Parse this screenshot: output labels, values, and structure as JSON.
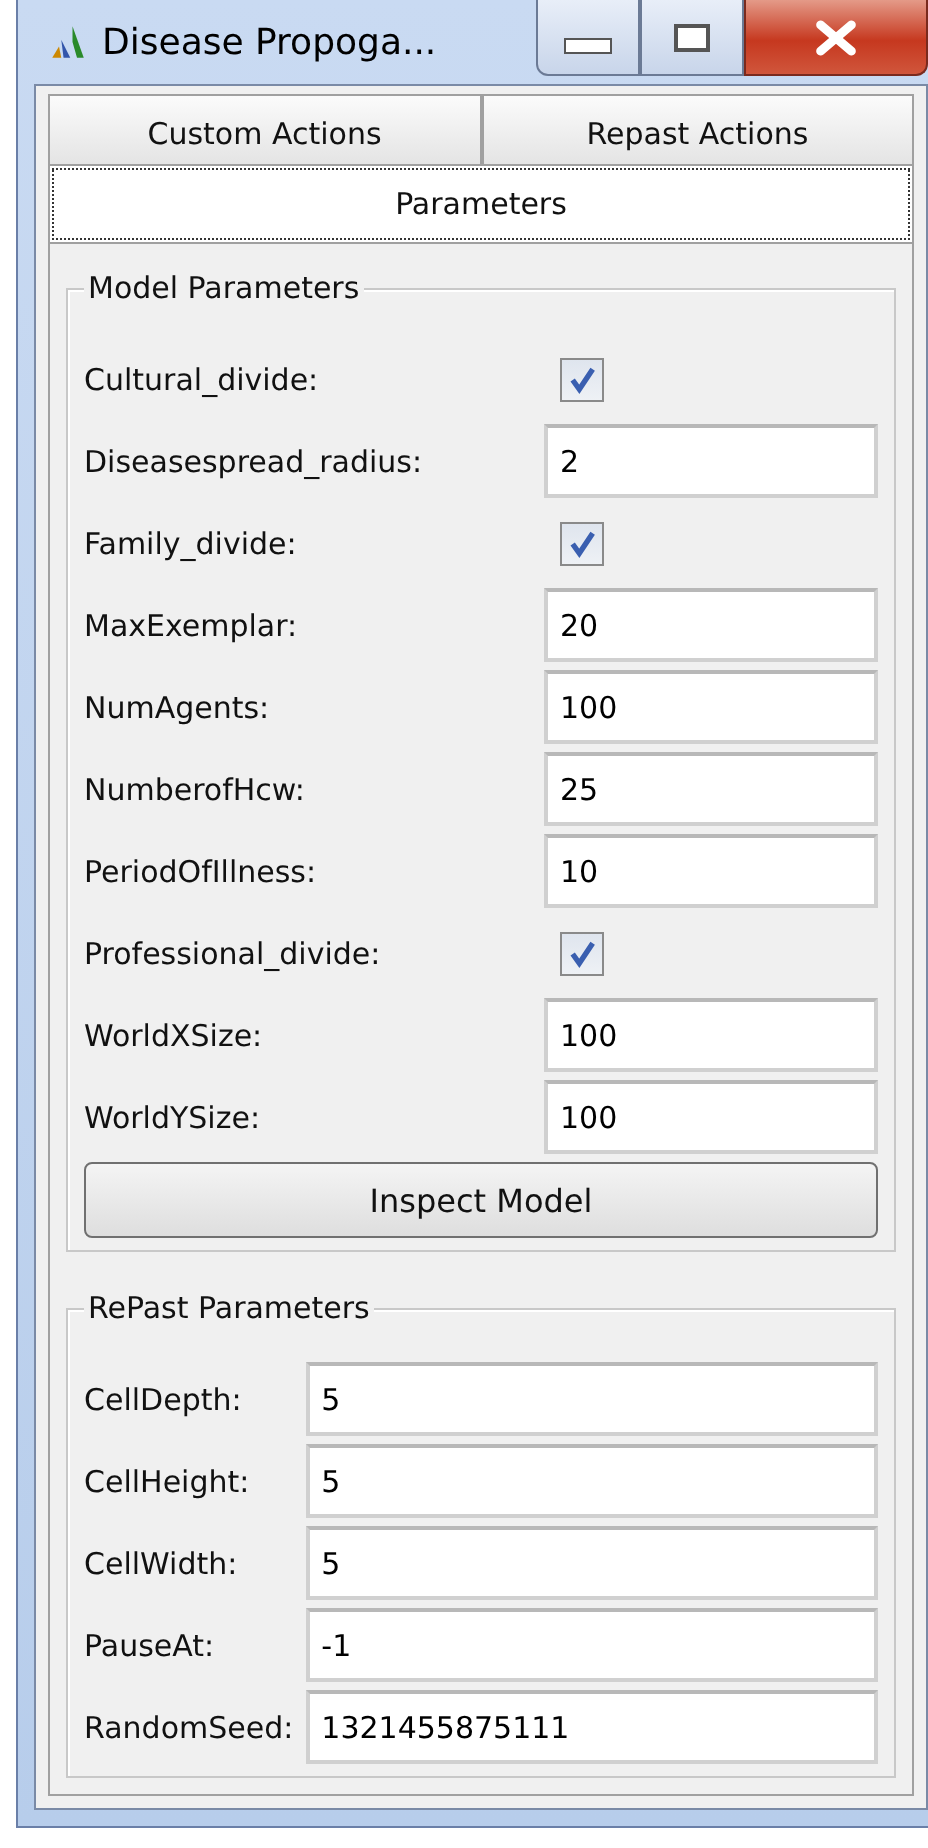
{
  "window": {
    "title": "Disease Propoga..."
  },
  "tabs": [
    {
      "label": "Custom Actions",
      "selected": false
    },
    {
      "label": "Repast Actions",
      "selected": false
    },
    {
      "label": "Parameters",
      "selected": true
    }
  ],
  "groups": [
    {
      "title": "Model Parameters",
      "fields": [
        {
          "kind": "checkbox",
          "label": "Cultural_divide:",
          "checked": true
        },
        {
          "kind": "text",
          "label": "Diseasespread_radius:",
          "value": "2"
        },
        {
          "kind": "checkbox",
          "label": "Family_divide:",
          "checked": true
        },
        {
          "kind": "text",
          "label": "MaxExemplar:",
          "value": "20"
        },
        {
          "kind": "text",
          "label": "NumAgents:",
          "value": "100"
        },
        {
          "kind": "text",
          "label": "NumberofHcw:",
          "value": "25"
        },
        {
          "kind": "text",
          "label": "PeriodOfIllness:",
          "value": "10"
        },
        {
          "kind": "checkbox",
          "label": "Professional_divide:",
          "checked": true
        },
        {
          "kind": "text",
          "label": "WorldXSize:",
          "value": "100"
        },
        {
          "kind": "text",
          "label": "WorldYSize:",
          "value": "100"
        }
      ],
      "button": "Inspect Model"
    },
    {
      "title": "RePast Parameters",
      "fields": [
        {
          "kind": "text",
          "label": "CellDepth:",
          "value": "5"
        },
        {
          "kind": "text",
          "label": "CellHeight:",
          "value": "5"
        },
        {
          "kind": "text",
          "label": "CellWidth:",
          "value": "5"
        },
        {
          "kind": "text",
          "label": "PauseAt:",
          "value": "-1"
        },
        {
          "kind": "text",
          "label": "RandomSeed:",
          "value": "1321455875111"
        }
      ]
    }
  ]
}
